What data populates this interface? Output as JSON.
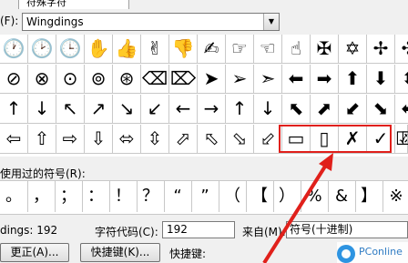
{
  "tab": {
    "label": "符殊字符"
  },
  "font": {
    "label": "(F):",
    "value": "Wingdings"
  },
  "grid": {
    "rows": [
      [
        "🕐",
        "🕑",
        "🕒",
        "✋",
        "👍",
        "✌",
        "👎",
        "✍",
        "☞",
        "☜",
        "☝",
        "✠",
        "✡",
        "✢",
        "✣"
      ],
      [
        "⊘",
        "⊗",
        "⊙",
        "⊚",
        "⊛",
        "⌫",
        "⌦",
        "➤",
        "➢",
        "➣",
        "⬅",
        "➡",
        "⬆",
        "⬇",
        "⬍"
      ],
      [
        "↑",
        "↓",
        "↖",
        "↗",
        "↘",
        "↙",
        "←",
        "→",
        "↑",
        "↓",
        "⬉",
        "⬈",
        "⬋",
        "⬊",
        "⬌"
      ],
      [
        "⇦",
        "⇧",
        "⇨",
        "⇩",
        "⬄",
        "⇳",
        "⬀",
        "⬁",
        "⬂",
        "⬃",
        "▭",
        "▯",
        "✗",
        "✓",
        "☒"
      ]
    ],
    "last_col_glyph": "☑"
  },
  "recent": {
    "label": "使用过的符号(R):",
    "symbols": [
      "。",
      "，",
      "；",
      "：",
      "！",
      "？",
      "“",
      "”",
      "（",
      "【",
      "）",
      "%",
      "&",
      "】",
      "※"
    ]
  },
  "status": {
    "font_name": "dings: 192",
    "code_label": "字符代码(C):",
    "code_value": "192",
    "from_label": "来自(M):",
    "from_value": "符号(十进制)"
  },
  "buttons": {
    "autocorrect": "更正(A)...",
    "shortcut_key": "快捷键(K)...",
    "shortcut_label": "快捷键:"
  },
  "watermark": {
    "text": "PConline"
  },
  "colors": {
    "highlight": "#e0201b",
    "arrow": "#e0201b"
  }
}
